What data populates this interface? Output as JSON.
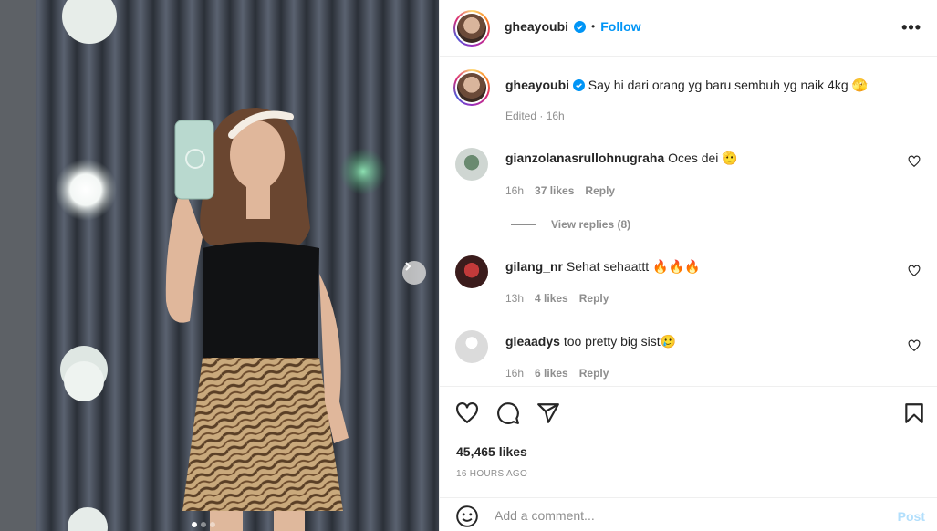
{
  "post": {
    "username": "gheayoubi",
    "follow_label": "Follow",
    "separator": "•",
    "more_label": "•••",
    "caption": "Say hi dari orang yg baru sembuh yg naik 4kg 🫣",
    "caption_meta": "Edited · 16h",
    "likes": "45,465 likes",
    "time_ago": "16 HOURS AGO",
    "comment_placeholder": "Add a comment...",
    "post_label": "Post",
    "image_count": 3,
    "image_index": 1
  },
  "comments": [
    {
      "username": "gianzolanasrullohnugraha",
      "text": "Oces dei 🫡",
      "time": "16h",
      "likes": "37 likes",
      "reply": "Reply",
      "view_replies": "View replies (8)"
    },
    {
      "username": "gilang_nr",
      "text": "Sehat sehaattt 🔥🔥🔥",
      "time": "13h",
      "likes": "4 likes",
      "reply": "Reply"
    },
    {
      "username": "gleaadys",
      "text": "too pretty big sist🥲",
      "time": "16h",
      "likes": "6 likes",
      "reply": "Reply"
    }
  ],
  "colors": {
    "accent": "#0095f6",
    "post_disabled": "#b2dffc",
    "muted": "#8e8e8e",
    "text": "#262626"
  },
  "icons": [
    "verified-icon",
    "more-icon",
    "heart-icon",
    "comment-icon",
    "share-icon",
    "bookmark-icon",
    "emoji-icon",
    "chevron-right-icon"
  ]
}
